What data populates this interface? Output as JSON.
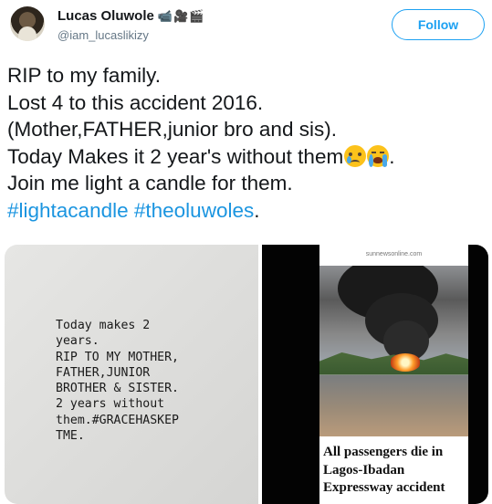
{
  "header": {
    "display_name": "Lucas Oluwole",
    "name_emojis": "📹🎥🎬",
    "handle": "@iam_lucaslikizy",
    "follow_label": "Follow"
  },
  "tweet": {
    "line1": "RIP  to my family.",
    "line2": "Lost 4 to this accident 2016.",
    "line3": "(Mother,FATHER,junior bro and sis).",
    "line4": "Today Makes it 2 year's without them",
    "line4_end": ".",
    "line5": "Join me light a candle for them.",
    "hashtag1": "#lightacandle",
    "hashtag2": "#theoluwoles",
    "line6_end": ".",
    "emojis": [
      "crying-face",
      "loudly-crying-face"
    ]
  },
  "media": {
    "story_text": "Today makes 2\nyears.\nRIP TO MY MOTHER,\nFATHER,JUNIOR\nBROTHER & SISTER.\n2 years without\nthem.#GRACEHASKEP\nTME.",
    "news_source": "sunnewsonline.com",
    "headline_line1": "All passengers die in",
    "headline_line2": "Lagos-Ibadan",
    "headline_line3": "Expressway accident"
  },
  "colors": {
    "link": "#1b95e0",
    "follow": "#1da1f2",
    "handle": "#657786"
  }
}
